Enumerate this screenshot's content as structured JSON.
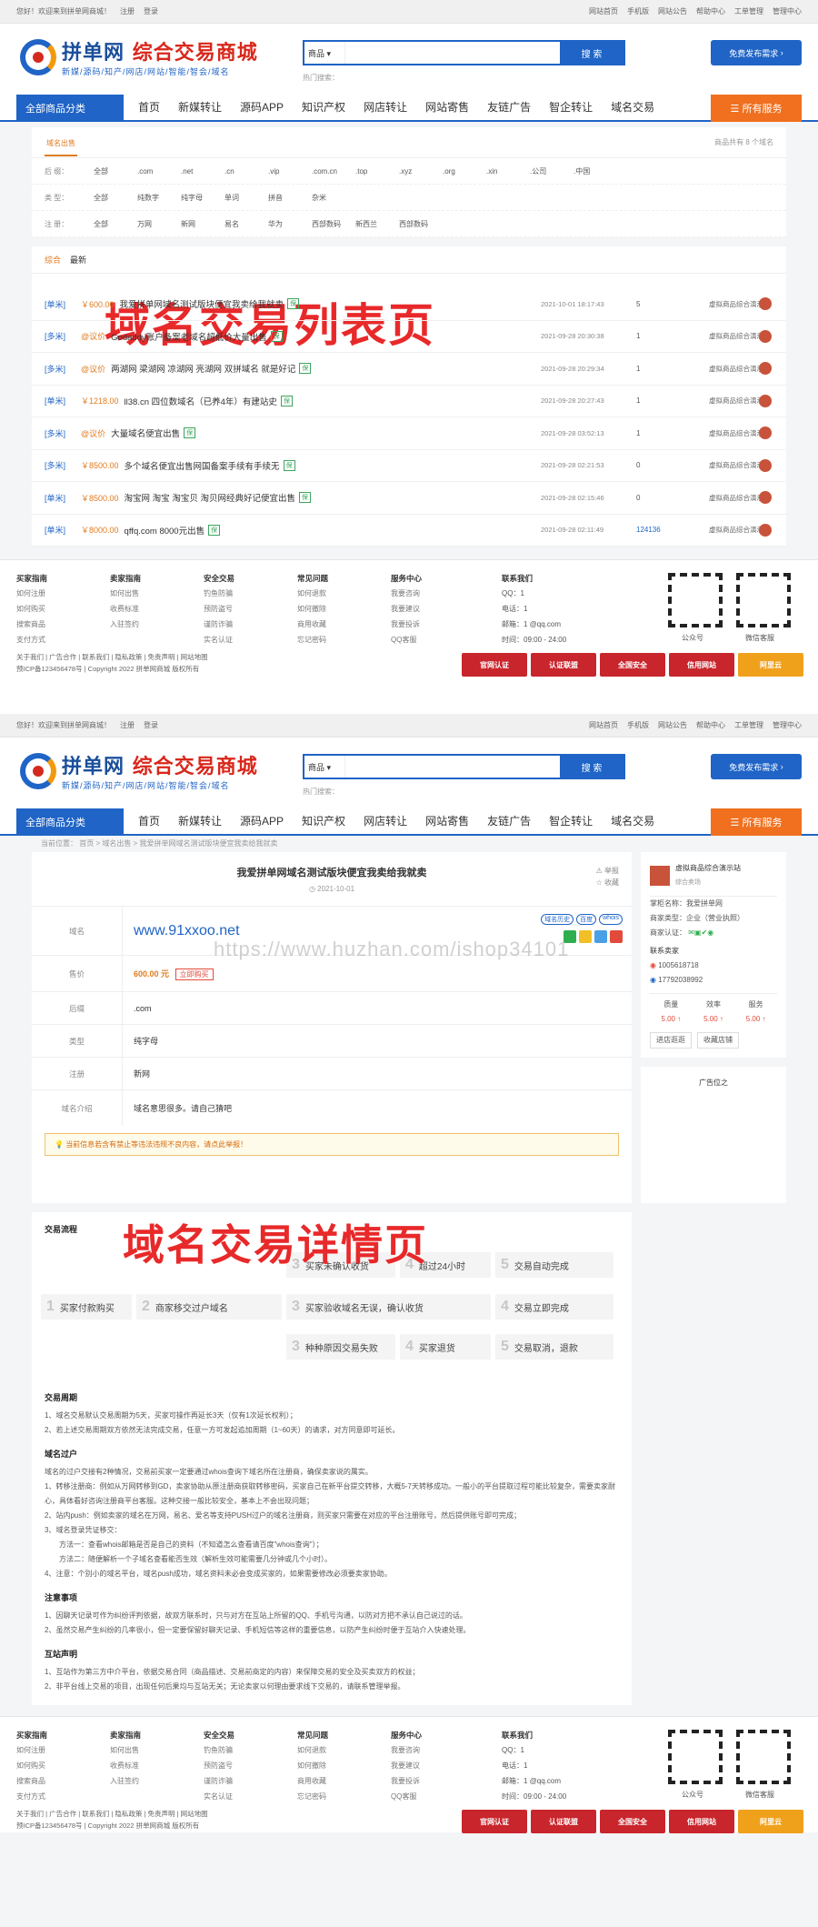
{
  "top": {
    "welcome": "您好！欢迎来到拼单网商城！",
    "register": "注册",
    "login": "登录",
    "links": [
      "网站首页",
      "手机版",
      "网站公告",
      "帮助中心",
      "工单管理",
      "管理中心"
    ]
  },
  "top2": {
    "welcome": "您好！欢迎来到拼单网商城！",
    "register": "注册",
    "login": "登录",
    "links": [
      "网站首页",
      "手机版",
      "网站公告",
      "帮助中心",
      "工单管理",
      "管理中心"
    ]
  },
  "header": {
    "logo_main": "拼单网",
    "logo_sub": "综合交易商城",
    "logo_slogan": "新媒/源码/知产/网店/网站/智能/智会/域名",
    "search_cat": "商品",
    "search_btn": "搜 索",
    "hot": "热门搜索：",
    "publish": "免费发布需求"
  },
  "nav": {
    "category": "全部商品分类",
    "items": [
      "首页",
      "新媒转让",
      "源码APP",
      "知识产权",
      "网店转让",
      "网站寄售",
      "友链广告",
      "智企转让",
      "域名交易"
    ],
    "all_service": "所有服务"
  },
  "list": {
    "filter_tab": "域名出售",
    "filter_count": "商品共有 8 个域名",
    "rows": [
      {
        "label": "后 缀：",
        "opts": [
          "全部",
          ".com",
          ".net",
          ".cn",
          ".vip",
          ".com.cn",
          ".top",
          ".xyz",
          ".org",
          ".xin",
          ".公司",
          ".中国"
        ]
      },
      {
        "label": "类 型：",
        "opts": [
          "全部",
          "纯数字",
          "纯字母",
          "单词",
          "拼音",
          "杂米"
        ]
      },
      {
        "label": "注 册：",
        "opts": [
          "全部",
          "万网",
          "新网",
          "易名",
          "华为",
          "西部数码",
          "新西兰",
          "西部数码"
        ]
      }
    ],
    "sort": [
      "综合",
      "最新"
    ],
    "overlay": "域名交易列表页",
    "items": [
      {
        "tag": "[单米]",
        "price": "￥600.00",
        "title": "我爱拼单网域名测试版块便宜我卖给我就卖",
        "time": "2021-10-01 18:17:43",
        "cnt": "5",
        "seller": "虚拟商品综合演示站"
      },
      {
        "tag": "[多米]",
        "price": "@议价",
        "title": "Godaddy账户备案老域名超低价大量出售",
        "time": "2021-09-28 20:30:38",
        "cnt": "1",
        "seller": "虚拟商品综合演示站"
      },
      {
        "tag": "[多米]",
        "price": "@议价",
        "title": "两湖网 梁湖网 凉湖网 亮湖网 双拼域名 就是好记",
        "time": "2021-09-28 20:29:34",
        "cnt": "1",
        "seller": "虚拟商品综合演示站"
      },
      {
        "tag": "[单米]",
        "price": "￥1218.00",
        "title": "ll38.cn 四位数域名（已养4年）有建站史",
        "time": "2021-09-28 20:27:43",
        "cnt": "1",
        "seller": "虚拟商品综合演示站"
      },
      {
        "tag": "[多米]",
        "price": "@议价",
        "title": "大量域名便宜出售",
        "time": "2021-09-28 03:52:13",
        "cnt": "1",
        "seller": "虚拟商品综合演示站"
      },
      {
        "tag": "[多米]",
        "price": "￥8500.00",
        "title": "多个域名便宜出售网国备案手续有手续无",
        "time": "2021-09-28 02:21:53",
        "cnt": "0",
        "seller": "虚拟商品综合演示站"
      },
      {
        "tag": "[单米]",
        "price": "￥8500.00",
        "title": "淘宝网 淘宝 淘宝贝 淘贝网经典好记便宜出售",
        "time": "2021-09-28 02:15:46",
        "cnt": "0",
        "seller": "虚拟商品综合演示站"
      },
      {
        "tag": "[单米]",
        "price": "￥8000.00",
        "title": "qffq.com 8000元出售",
        "time": "2021-09-28 02:11:49",
        "cnt": "124136",
        "seller": "虚拟商品综合演示站"
      }
    ],
    "safe": "保"
  },
  "footer": {
    "cols": [
      {
        "h": "买家指南",
        "items": [
          "如何注册",
          "如何购买",
          "搜索商品",
          "支付方式"
        ]
      },
      {
        "h": "卖家指南",
        "items": [
          "如何出售",
          "收费标准",
          "入驻签约"
        ]
      },
      {
        "h": "安全交易",
        "items": [
          "钓鱼防骗",
          "预防盗号",
          "谨防诈骗",
          "实名认证"
        ]
      },
      {
        "h": "常见问题",
        "items": [
          "如何退款",
          "如何撤除",
          "商用收藏",
          "忘记密码"
        ]
      },
      {
        "h": "服务中心",
        "items": [
          "我要咨询",
          "我要建议",
          "我要投诉",
          "QQ客服"
        ]
      }
    ],
    "contact_h": "联系我们",
    "contact": [
      "QQ：1",
      "电话：1",
      "邮箱：1 @qq.com",
      "时间：09:00 - 24:00"
    ],
    "qr1": "公众号",
    "qr2": "微信客服",
    "links": "关于我们  |  广告合作  |  联系我们  |  隐私政策  |  免责声明  |  网站地图",
    "icp": "预ICP备123456478号  |  Copyright 2022 拼单网商城 版权所有",
    "badges": [
      "官网认证",
      "认证联盟",
      "全国安全",
      "信用网站",
      "阿里云"
    ]
  },
  "detail": {
    "crumb": "当前位置： 首页 > 域名出售 > 我爱拼单网域名测试版块便宜我卖给我就卖",
    "title": "我爱拼单网域名测试版块便宜我卖给我就卖",
    "date": "2021-10-01",
    "report": "举报",
    "fav": "收藏",
    "keys": [
      "域名",
      "售价",
      "后缀",
      "类型",
      "注册",
      "域名介绍"
    ],
    "domain": "www.91xxoo.net",
    "tags": [
      "域名历史",
      "百度",
      "whois"
    ],
    "price": "600.00 元",
    "buy": "立即购买",
    "suffix": ".com",
    "type": "纯字母",
    "reg": "新网",
    "intro": "域名意思很多。请自己猜吧",
    "notice": "当前信息若含有禁止等违法违规不良内容，请点此举报！",
    "watermark": "https://www.huzhan.com/ishop34101",
    "overlay": "域名交易详情页",
    "seller_name": "虚拟商品综合演示站",
    "seller_sub": "综合卖场",
    "seller_lines": [
      "掌柜名称：我爱拼单网",
      "商家类型：企业（营业执照）",
      "商家认证："
    ],
    "contact_h": "联系卖家",
    "phone1": "1005618718",
    "phone2": "17792038992",
    "scores": [
      {
        "k": "质量",
        "v": "5.00 ↑"
      },
      {
        "k": "效率",
        "v": "5.00 ↑"
      },
      {
        "k": "服务",
        "v": "5.00 ↑"
      }
    ],
    "shop_btns": [
      "进店逛逛",
      "收藏店铺"
    ],
    "ad_h": "广告位之",
    "flow_h": "交易流程",
    "flow": [
      {
        "n": "1",
        "t": "买家付款购买"
      },
      {
        "n": "2",
        "t": "商家移交过户域名"
      },
      {
        "n": "3",
        "t": "买家未确认收货"
      },
      {
        "n": "4",
        "t": "超过24小时"
      },
      {
        "n": "5",
        "t": "交易自动完成"
      },
      {
        "n": "3",
        "t": "买家验收域名无误，确认收货"
      },
      {
        "n": "4",
        "t": "交易立即完成"
      },
      {
        "n": "3",
        "t": "种种原因交易失败"
      },
      {
        "n": "4",
        "t": "买家退货"
      },
      {
        "n": "5",
        "t": "交易取消，退款"
      }
    ],
    "period_h": "交易周期",
    "period": [
      "1、域名交易默认交易周期为5天，买家可操作再延长3天（仅有1次延长权利）；",
      "2、若上述交易周期双方依然无法完成交易，任意一方可发起追加周期（1~60天）的请求，对方同意即可延长。"
    ],
    "transfer_h": "域名过户",
    "transfer": [
      "域名的过户交接有2种情况，交易前买家一定要通过whois查询下域名所在注册商，确保卖家说的属实。",
      "1、转移注册商：例如从万网转移到GD，卖家协助从原注册商获取转移密码，买家自己在新平台提交转移，大概5-7天转移成功。一般小的平台提取过程可能比较复杂，需要卖家耐心，具体看好咨询注册商平台客服。这种交接一般比较安全，基本上不会出现问题；",
      "2、站内push：例如卖家的域名在万网，易名、爱名等支持PUSH过户的域名注册商，则买家只需要在对应的平台注册账号，然后提供账号即可完成；",
      "3、域名登录凭证移交：",
      "方法一：查看whois邮箱是否是自己的资料（不知道怎么查看请百度\"whois查询\"）；",
      "方法二：随便解析一个子域名查看能否生效（解析生效可能需要几分钟或几个小时）。",
      "4、注意：个别小的域名平台，域名push成功，域名资料未必会变成买家的，如果需要修改必须要卖家协助。"
    ],
    "attention_h": "注意事项",
    "attention": [
      "1、因聊天记录可作为纠纷评判依据，故双方联系时，只与对方在互站上所留的QQ、手机号沟通，以防对方把不承认自己说过的话。",
      "2、虽然交易产生纠纷的几率很小，但一定要保留好聊天记录、手机短信等这样的重要信息，以防产生纠纷时便于互站介入快速处理。"
    ],
    "disclaim_h": "互站声明",
    "disclaim": [
      "1、互站作为第三方中介平台，依据交易合同（商品描述、交易前商定的内容）来保障交易的安全及买卖双方的权益；",
      "2、非平台线上交易的项目，出现任何后果均与互站无关；无论卖家以何理由要求线下交易的，请联系管理举报。"
    ]
  }
}
